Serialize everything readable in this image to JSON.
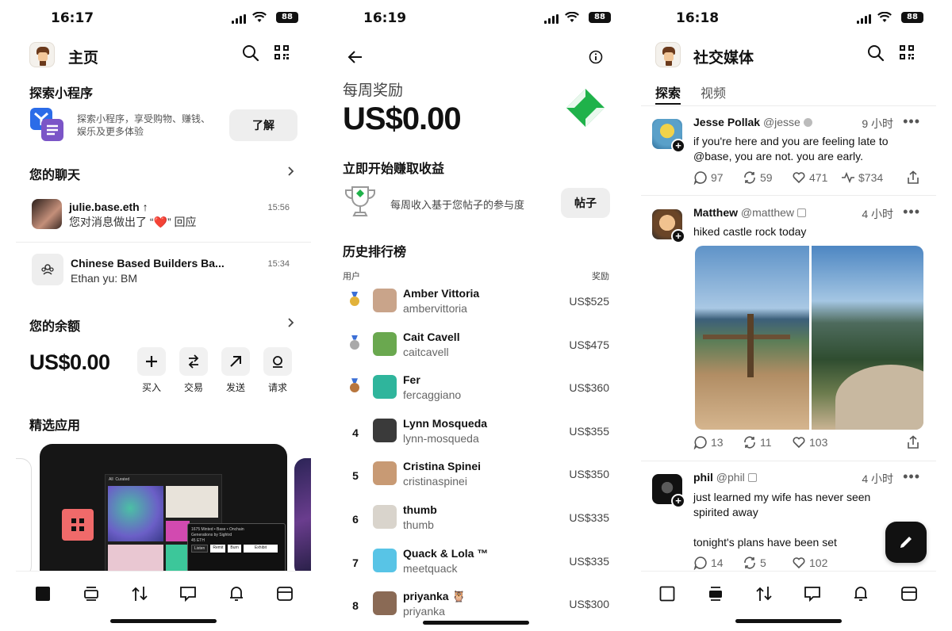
{
  "screen_home": {
    "time": "16:17",
    "battery": "88",
    "title": "主页",
    "miniapps": {
      "heading": "探索小程序",
      "description_line1": "探索小程序，享受购物、赚钱、",
      "description_line2": "娱乐及更多体验",
      "button": "了解"
    },
    "chats": {
      "heading": "您的聊天",
      "items": [
        {
          "name": "julie.base.eth",
          "message": "您对消息做出了 “❤️” 回应",
          "time": "15:56"
        },
        {
          "name": "Chinese Based Builders Ba...",
          "message": "Ethan yu: BM",
          "time": "15:34"
        }
      ]
    },
    "balance": {
      "heading": "您的余额",
      "amount": "US$0.00",
      "actions": [
        {
          "label": "买入",
          "icon": "plus-icon"
        },
        {
          "label": "交易",
          "icon": "swap-icon"
        },
        {
          "label": "发送",
          "icon": "send-arrow-icon"
        },
        {
          "label": "请求",
          "icon": "request-icon"
        }
      ]
    },
    "featured": {
      "heading": "精选应用",
      "card_tab_all": "All",
      "card_tab_curated": "Curated",
      "card_line1": "1675 Minted • Base • Onchain",
      "card_line2": "Generations by Sightrd",
      "card_price": "45 ETH",
      "card_buttons": [
        "Listen",
        "Remit",
        "Burn",
        "Exhibit"
      ]
    }
  },
  "screen_rewards": {
    "time": "16:19",
    "battery": "88",
    "label": "每周奖励",
    "amount": "US$0.00",
    "start_heading": "立即开始赚取收益",
    "start_description": "每周收入基于您帖子的参与度",
    "posts_button": "帖子",
    "leaderboard_heading": "历史排行榜",
    "col_user": "用户",
    "col_reward": "奖励",
    "leaderboard": [
      {
        "rank": "",
        "medal": "gold",
        "name": "Amber Vittoria",
        "handle": "ambervittoria",
        "reward": "US$525",
        "color": "#c9a48a"
      },
      {
        "rank": "",
        "medal": "silver",
        "name": "Cait Cavell",
        "handle": "caitcavell",
        "reward": "US$475",
        "color": "#6aa84f"
      },
      {
        "rank": "",
        "medal": "bronze",
        "name": "Fer",
        "handle": "fercaggiano",
        "reward": "US$360",
        "color": "#2fb59c"
      },
      {
        "rank": "4",
        "medal": "",
        "name": "Lynn Mosqueda",
        "handle": "lynn-mosqueda",
        "reward": "US$355",
        "color": "#3a3a3a"
      },
      {
        "rank": "5",
        "medal": "",
        "name": "Cristina Spinei",
        "handle": "cristinaspinei",
        "reward": "US$350",
        "color": "#c89a74"
      },
      {
        "rank": "6",
        "medal": "",
        "name": "thumb",
        "handle": "thumb",
        "reward": "US$335",
        "color": "#d9d4cc"
      },
      {
        "rank": "7",
        "medal": "",
        "name": "Quack & Lola ™",
        "handle": "meetquack",
        "reward": "US$335",
        "color": "#58c4e6"
      },
      {
        "rank": "8",
        "medal": "",
        "name": "priyanka 🦉",
        "handle": "priyanka",
        "reward": "US$300",
        "color": "#8a6a55"
      }
    ]
  },
  "screen_social": {
    "time": "16:18",
    "battery": "88",
    "title": "社交媒体",
    "tabs": [
      "探索",
      "视频"
    ],
    "posts": [
      {
        "name": "Jesse Pollak",
        "handle": "@jesse",
        "time": "9 小时",
        "text_lines": [
          "if you're here and you are feeling late to",
          "@base, you are not. you are early."
        ],
        "replies": "97",
        "recasts": "59",
        "likes": "471",
        "earnings": "$734"
      },
      {
        "name": "Matthew",
        "handle": "@matthew",
        "time": "4 小时",
        "text_lines": [
          "hiked castle rock today"
        ],
        "replies": "13",
        "recasts": "11",
        "likes": "103"
      },
      {
        "name": "phil",
        "handle": "@phil",
        "time": "4 小时",
        "text_lines": [
          "just learned my wife has never seen",
          "spirited away",
          "",
          "tonight's plans have been set"
        ],
        "replies": "14",
        "recasts": "5",
        "likes": "102"
      }
    ]
  },
  "colors": {
    "accent_green": "#1fb24a",
    "text_primary": "#111111",
    "text_secondary": "#666666",
    "button_grey": "#eeeeee"
  }
}
